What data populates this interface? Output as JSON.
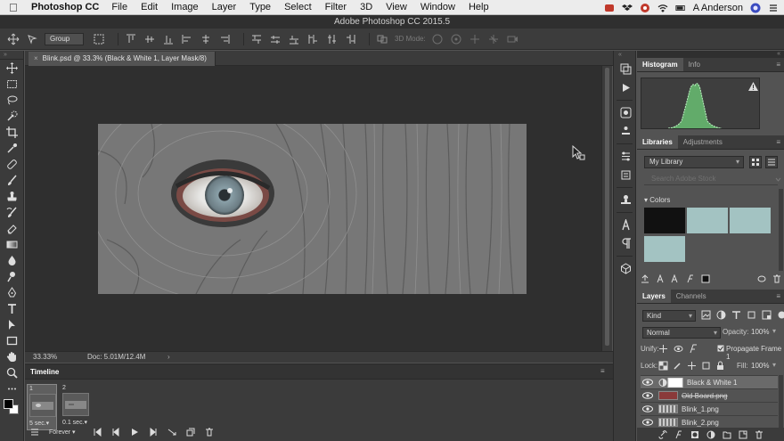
{
  "menubar": {
    "app_name": "Photoshop CC",
    "items": [
      "File",
      "Edit",
      "Image",
      "Layer",
      "Type",
      "Select",
      "Filter",
      "3D",
      "View",
      "Window",
      "Help"
    ],
    "user": "A Anderson"
  },
  "window_title": "Adobe Photoshop CC 2015.5",
  "options_bar": {
    "auto_select_value": "Group",
    "mode_label": "3D Mode:"
  },
  "document": {
    "tab_label": "Blink.psd @ 33.3% (Black & White 1, Layer Mask/8)",
    "close_glyph": "×"
  },
  "status_bar": {
    "zoom": "33.33%",
    "doc_size": "Doc: 5.01M/12.4M",
    "arrow": "›"
  },
  "timeline": {
    "title": "Timeline",
    "frames": [
      {
        "number": "1",
        "duration": "5 sec.▾",
        "selected": true
      },
      {
        "number": "2",
        "duration": "0.1 sec.▾",
        "selected": false
      }
    ],
    "loop": "Forever ▾"
  },
  "histogram_panel": {
    "tabs": [
      "Histogram",
      "Info"
    ],
    "active_tab": "Histogram",
    "series_color": "#6fd07a"
  },
  "libraries_panel": {
    "tabs": [
      "Libraries",
      "Adjustments"
    ],
    "active_tab": "Libraries",
    "library_name": "My Library",
    "search_placeholder": "Search Adobe Stock",
    "section_label": "▾ Colors",
    "colors": [
      "#111111",
      "#a3c3c2",
      "#a3c3c2",
      "#a3c3c2"
    ]
  },
  "layers_panel": {
    "tabs": [
      "Layers",
      "Channels"
    ],
    "active_tab": "Layers",
    "filter_kind": "Kind",
    "blend_mode": "Normal",
    "opacity_label": "Opacity:",
    "opacity_value": "100%",
    "unify_label": "Unify:",
    "propagate_label": "Propagate Frame 1",
    "lock_label": "Lock:",
    "fill_label": "Fill:",
    "fill_value": "100%",
    "layers": [
      {
        "name": "Black & White 1",
        "active": true
      },
      {
        "name": "Old Board.png",
        "active": false
      },
      {
        "name": "Blink_1.png",
        "active": false
      },
      {
        "name": "Blink_2.png",
        "active": false
      }
    ]
  }
}
